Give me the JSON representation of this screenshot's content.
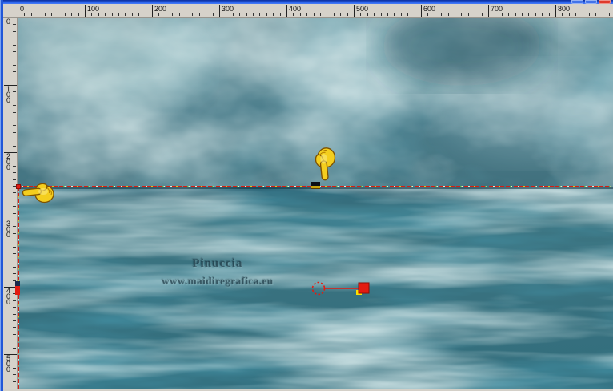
{
  "window": {
    "top_strip_color": "#2e68f2",
    "left_strip_color": "#2157d8",
    "controls": [
      {
        "name": "minimize",
        "color": "#4273e9"
      },
      {
        "name": "maximize",
        "color": "#4273e9"
      },
      {
        "name": "close",
        "color": "#df3a2b"
      }
    ]
  },
  "rulers": {
    "top_labels": [
      "0",
      "100",
      "200",
      "300",
      "400",
      "500",
      "600",
      "700",
      "800"
    ],
    "left_labels": [
      "0",
      "100",
      "200",
      "300",
      "400",
      "500"
    ]
  },
  "canvas": {
    "watermark_line1": "Pinuccia",
    "watermark_line2": "www.maidiregrafica.eu",
    "colors": {
      "sky_light": "#8db0b5",
      "sky_base": "#4d7f8d",
      "sky_dark": "#2e6574",
      "water_light": "#86adb2",
      "water_base": "#3d7582",
      "water_dark": "#1d5768",
      "selection_red": "#d81c12",
      "handle_red": "#e31b10",
      "handle_yellow": "#ffe000",
      "node_black": "#0c0f14",
      "node_olive": "#c8a40a",
      "hand_yellow": "#f4ce1e"
    }
  },
  "icons": {
    "left_hand": "pointing-hand-left-icon",
    "down_hand": "pointing-hand-down-icon",
    "pivot": "rotation-pivot-icon"
  }
}
